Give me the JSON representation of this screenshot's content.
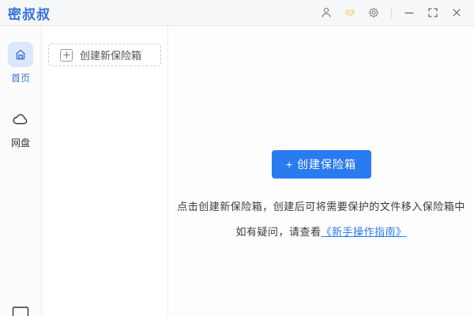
{
  "window": {
    "app_name": "密叔叔"
  },
  "titlebar": {
    "icons": [
      "user-icon",
      "vip-diamond-icon",
      "settings-gear-icon",
      "minimize-icon",
      "maximize-icon",
      "close-icon"
    ]
  },
  "sidebar": {
    "items": [
      {
        "label": "首页",
        "icon": "home-icon",
        "active": true
      },
      {
        "label": "网盘",
        "icon": "cloud-icon",
        "active": false
      }
    ],
    "bottom_icon": "device-icon"
  },
  "vault_panel": {
    "create_new_label": "创建新保险箱",
    "plus_icon": "plus-icon"
  },
  "main": {
    "create_button_label": "+ 创建保险箱",
    "hint_line1": "点击创建新保险箱，创建后可将需要保护的文件移入保险箱中",
    "hint_line2_prefix": "如有疑问，请查看",
    "guide_link_label": "《新手操作指南》"
  },
  "colors": {
    "logo_blue": "#3370dd",
    "accent_blue": "#2b7bf0",
    "link_blue": "#2b7bf0",
    "active_tile_bg": "#dbe7fb",
    "vip_gold": "#f3da9b",
    "titlebar_bg": "#f6f7f8"
  }
}
